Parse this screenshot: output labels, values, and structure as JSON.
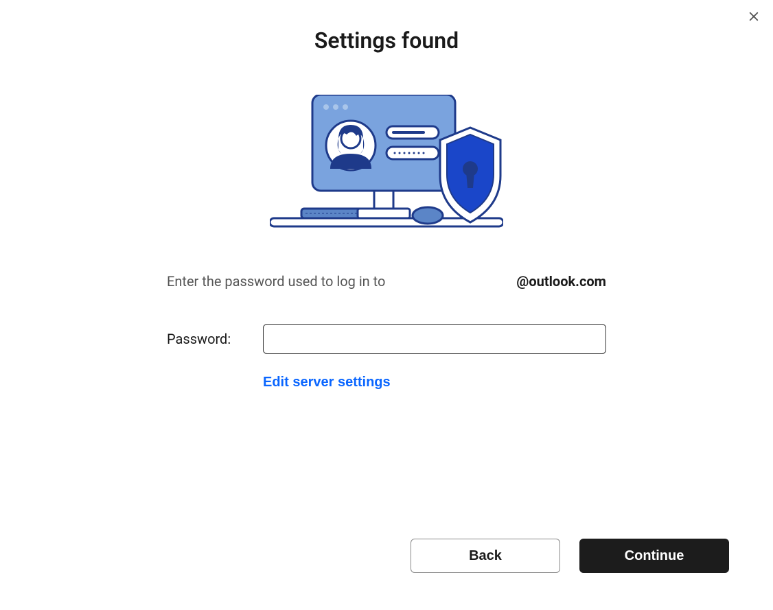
{
  "dialog": {
    "title": "Settings found",
    "instruction_prefix": "Enter the password used to log in to ",
    "email_suffix": "@outlook.com",
    "password_label": "Password:",
    "password_value": "",
    "edit_settings_label": "Edit server settings",
    "back_label": "Back",
    "continue_label": "Continue"
  }
}
